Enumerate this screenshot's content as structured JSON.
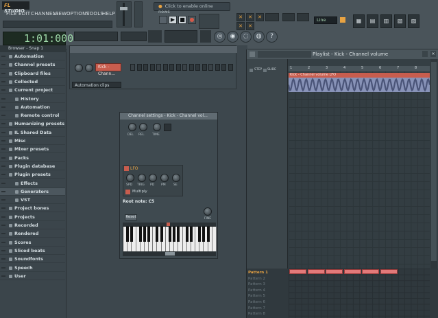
{
  "app": {
    "logo_prefix": "FL",
    "logo_name": "STUDIO"
  },
  "menu": [
    "FILE",
    "EDIT",
    "CHANNELS",
    "VIEW",
    "OPTIONS",
    "TOOLS",
    "HELP"
  ],
  "news": {
    "text": "Click to enable online news"
  },
  "transport": {
    "time": "1:01:000"
  },
  "toolbar": {
    "snap_label": "Line"
  },
  "browser": {
    "header": "Browser - Snap 1",
    "items": [
      {
        "label": "Automation",
        "level": 0
      },
      {
        "label": "Channel presets",
        "level": 0
      },
      {
        "label": "Clipboard files",
        "level": 0
      },
      {
        "label": "Collected",
        "level": 0
      },
      {
        "label": "Current project",
        "level": 0
      },
      {
        "label": "History",
        "level": 1
      },
      {
        "label": "Automation",
        "level": 1
      },
      {
        "label": "Remote control",
        "level": 1
      },
      {
        "label": "Humanizing presets",
        "level": 0
      },
      {
        "label": "IL Shared Data",
        "level": 0
      },
      {
        "label": "Misc",
        "level": 0
      },
      {
        "label": "Mixer presets",
        "level": 0
      },
      {
        "label": "Packs",
        "level": 0
      },
      {
        "label": "Plugin database",
        "level": 0
      },
      {
        "label": "Plugin presets",
        "level": 0
      },
      {
        "label": "Effects",
        "level": 1
      },
      {
        "label": "Generators",
        "level": 1
      },
      {
        "label": "VST",
        "level": 1
      },
      {
        "label": "Project bones",
        "level": 0
      },
      {
        "label": "Projects",
        "level": 0
      },
      {
        "label": "Recorded",
        "level": 0
      },
      {
        "label": "Rendered",
        "level": 0
      },
      {
        "label": "Scores",
        "level": 0
      },
      {
        "label": "Sliced beats",
        "level": 0
      },
      {
        "label": "Soundfonts",
        "level": 0
      },
      {
        "label": "Speech",
        "level": 0
      },
      {
        "label": "User",
        "level": 0
      }
    ]
  },
  "step_sequencer": {
    "channel_button": "Kick - Chann...",
    "filter_label": "Automation clips"
  },
  "channel_settings": {
    "title": "Channel settings - Kick - Channel vol...",
    "top_knobs": [
      "DEL",
      "REL",
      "TIME"
    ],
    "lfo_title": "LFO",
    "lfo_knobs": [
      "SPD",
      "TRIG",
      "PD",
      "PM",
      "SE"
    ],
    "multiply_label": "Multiply",
    "root_note": "Root note: C5",
    "reset_label": "Reset",
    "fine_label": "FINE"
  },
  "playlist": {
    "title": "Playlist - Kick - Channel volume",
    "step_label": "STEP",
    "slide_label": "SLIDE",
    "clip_title": "Kick - Channel volume LFO",
    "ruler": [
      "1",
      "2",
      "3",
      "4",
      "5",
      "6",
      "7",
      "8"
    ],
    "patterns": [
      "Pattern 1",
      "Pattern 2",
      "Pattern 3",
      "Pattern 4",
      "Pattern 5",
      "Pattern 6",
      "Pattern 7",
      "Pattern 8"
    ]
  },
  "colors": {
    "accent": "#e8a342",
    "clip": "#c85d4e",
    "pattern_block": "#e27a7a"
  }
}
